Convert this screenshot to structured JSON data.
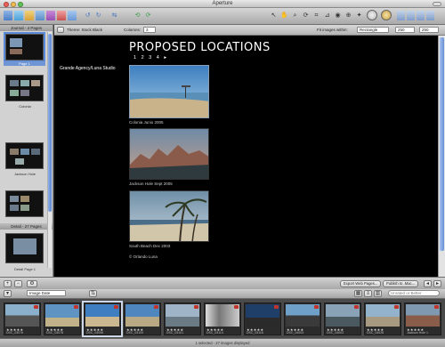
{
  "window": {
    "title": "Aperture"
  },
  "left_panel": {
    "section1_header": "Journal - 4 Pages",
    "pages": [
      {
        "caption": "Page 1",
        "selected": true
      },
      {
        "caption": "Colonia",
        "selected": false
      },
      {
        "caption": "Jackson Hole",
        "selected": false
      },
      {
        "caption": "",
        "selected": false
      }
    ],
    "section2_header": "Detail - 27 Pages",
    "detail_pages": [
      {
        "caption": "Detail Page 1"
      }
    ]
  },
  "main_bar": {
    "theme_label": "Theme: Stock Black",
    "columns_label": "Columns:",
    "columns_value": "3",
    "fit_label": "Fit images within:",
    "fit_value": "Rectangle",
    "width_value": "250",
    "height_value": "250"
  },
  "page": {
    "title": "PROPOSED LOCATIONS",
    "pagination": "1 2 3 4 ▸",
    "studio": "Grande Agency/Luna Studio",
    "photos": [
      {
        "caption": "Colonia Junio 2005"
      },
      {
        "caption": "Jackson Hole Sept 2005"
      },
      {
        "caption": "South Beach Dec 2003"
      }
    ],
    "copyright": "© Orlando Luna"
  },
  "viewer_bar": {
    "export_label": "Export Web Pages...",
    "publish_label": "Publish to .Mac..."
  },
  "strip_bar": {
    "sort_value": "Image Date",
    "search_placeholder": "Unrated or Better"
  },
  "filmstrip": [
    {
      "name": "DSC_03076",
      "stars": "★★★★★",
      "selected": false
    },
    {
      "name": "DSC_03078",
      "stars": "★★★★★",
      "selected": false
    },
    {
      "name": "DSC_03096",
      "stars": "★★★★★",
      "selected": true
    },
    {
      "name": "DSC_03100",
      "stars": "★★★★★",
      "selected": false
    },
    {
      "name": "DSC_03101",
      "stars": "★★★★★",
      "selected": false
    },
    {
      "name": "DSC_03114",
      "stars": "★★★★★",
      "selected": false
    },
    {
      "name": "DSC_03116",
      "stars": "★★★★★",
      "selected": false
    },
    {
      "name": "DSC_04003",
      "stars": "★★★★★",
      "selected": false
    },
    {
      "name": "DSC_04003",
      "stars": "★★★★★",
      "selected": false
    },
    {
      "name": "DSC_04028",
      "stars": "★★★★★",
      "selected": false
    },
    {
      "name": "Jackson Hole 1",
      "stars": "★★★★★",
      "selected": false
    }
  ],
  "status": {
    "text": "1 selected - 27 images displayed"
  },
  "colors": {
    "accent": "#5b8ad8",
    "canvas": "#000000",
    "badge": "#c0342c"
  }
}
